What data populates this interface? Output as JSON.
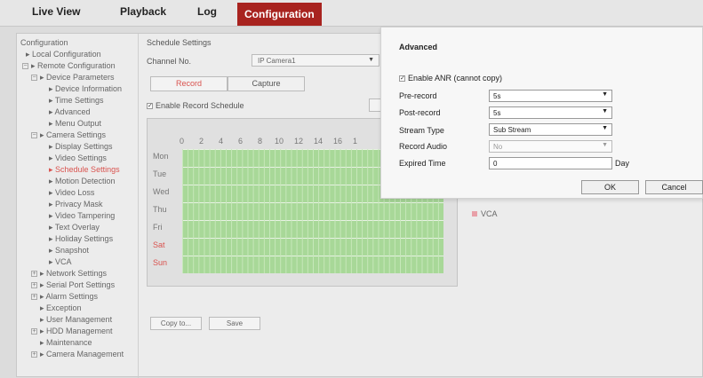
{
  "nav": {
    "live_view": "Live View",
    "playback": "Playback",
    "log": "Log",
    "configuration": "Configuration"
  },
  "tree": {
    "root": "Configuration",
    "local": "Local Configuration",
    "remote": "Remote Configuration",
    "device_params": "Device Parameters",
    "device_info": "Device Information",
    "time_settings": "Time Settings",
    "advanced": "Advanced",
    "menu_output": "Menu Output",
    "camera_settings": "Camera Settings",
    "display_settings": "Display Settings",
    "video_settings": "Video Settings",
    "schedule_settings": "Schedule Settings",
    "motion_detection": "Motion Detection",
    "video_loss": "Video Loss",
    "privacy_mask": "Privacy Mask",
    "video_tampering": "Video Tampering",
    "text_overlay": "Text Overlay",
    "holiday_settings": "Holiday Settings",
    "snapshot": "Snapshot",
    "vca": "VCA",
    "network_settings": "Network Settings",
    "serial_port": "Serial Port Settings",
    "alarm_settings": "Alarm Settings",
    "exception": "Exception",
    "user_management": "User Management",
    "hdd_management": "HDD Management",
    "maintenance": "Maintenance",
    "camera_management": "Camera Management"
  },
  "schedule": {
    "title": "Schedule Settings",
    "channel_label": "Channel No.",
    "channel_value": "IP Camera1",
    "tab_record": "Record",
    "tab_capture": "Capture",
    "enable_label": "Enable Record Schedule",
    "edit_button": "E",
    "hours": [
      "0",
      "2",
      "4",
      "6",
      "8",
      "10",
      "12",
      "14",
      "16",
      "1"
    ],
    "days": [
      "Mon",
      "Tue",
      "Wed",
      "Thu",
      "Fri",
      "Sat",
      "Sun"
    ],
    "legend_vca": "VCA",
    "copy_button": "Copy to...",
    "save_button": "Save"
  },
  "dialog": {
    "title": "Advanced",
    "enable_anr": "Enable ANR (cannot copy)",
    "pre_record_label": "Pre-record",
    "pre_record_value": "5s",
    "post_record_label": "Post-record",
    "post_record_value": "5s",
    "stream_type_label": "Stream Type",
    "stream_type_value": "Sub Stream",
    "record_audio_label": "Record Audio",
    "record_audio_value": "No",
    "expired_time_label": "Expired Time",
    "expired_time_value": "0",
    "day_unit": "Day",
    "ok": "OK",
    "cancel": "Cancel"
  },
  "colors": {
    "accent": "#a8231f",
    "highlight": "#d9534f",
    "schedule_fill": "#a8d898"
  }
}
